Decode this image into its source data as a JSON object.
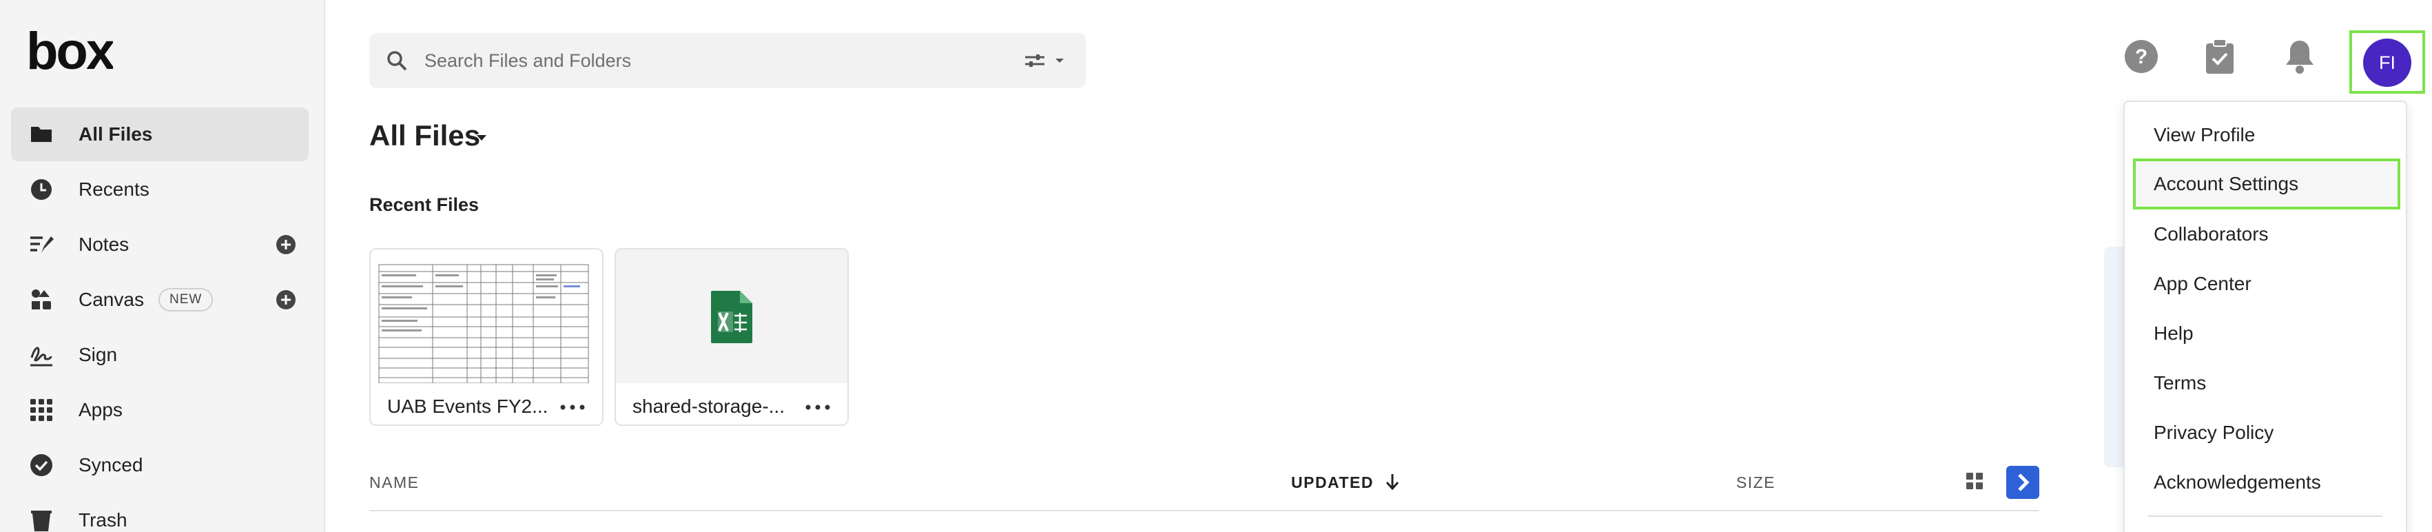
{
  "app": {
    "logo_text": "box"
  },
  "sidebar": {
    "items": [
      {
        "label": "All Files",
        "icon": "folder-icon",
        "active": true
      },
      {
        "label": "Recents",
        "icon": "clock-icon"
      },
      {
        "label": "Notes",
        "icon": "notes-icon",
        "has_add": true
      },
      {
        "label": "Canvas",
        "icon": "canvas-icon",
        "badge": "NEW",
        "has_add": true
      },
      {
        "label": "Sign",
        "icon": "signature-icon"
      },
      {
        "label": "Apps",
        "icon": "apps-grid-icon"
      },
      {
        "label": "Synced",
        "icon": "check-circle-icon"
      },
      {
        "label": "Trash",
        "icon": "trash-icon"
      }
    ]
  },
  "header": {
    "search": {
      "placeholder": "Search Files and Folders",
      "value": ""
    },
    "icons": [
      "help-icon",
      "tasks-icon",
      "bell-icon"
    ],
    "avatar_initials": "FI",
    "avatar_color": "#4826c2"
  },
  "main": {
    "title": "All Files",
    "recent_files_heading": "Recent Files",
    "recent_files": [
      {
        "name": "UAB Events FY2...",
        "thumb": "spreadsheet-preview"
      },
      {
        "name": "shared-storage-...",
        "thumb": "excel-file-icon"
      }
    ],
    "columns": {
      "name": "NAME",
      "updated": "UPDATED",
      "size": "SIZE"
    }
  },
  "account_menu": {
    "items": [
      {
        "label": "View Profile"
      },
      {
        "label": "Account Settings",
        "highlighted": true
      },
      {
        "label": "Collaborators"
      },
      {
        "label": "App Center"
      },
      {
        "label": "Help"
      },
      {
        "label": "Terms"
      },
      {
        "label": "Privacy Policy"
      },
      {
        "label": "Acknowledgements"
      }
    ]
  },
  "colors": {
    "accent_blue": "#2e61d6",
    "highlight_green": "#7ce34a",
    "excel_green": "#1f7a45"
  }
}
